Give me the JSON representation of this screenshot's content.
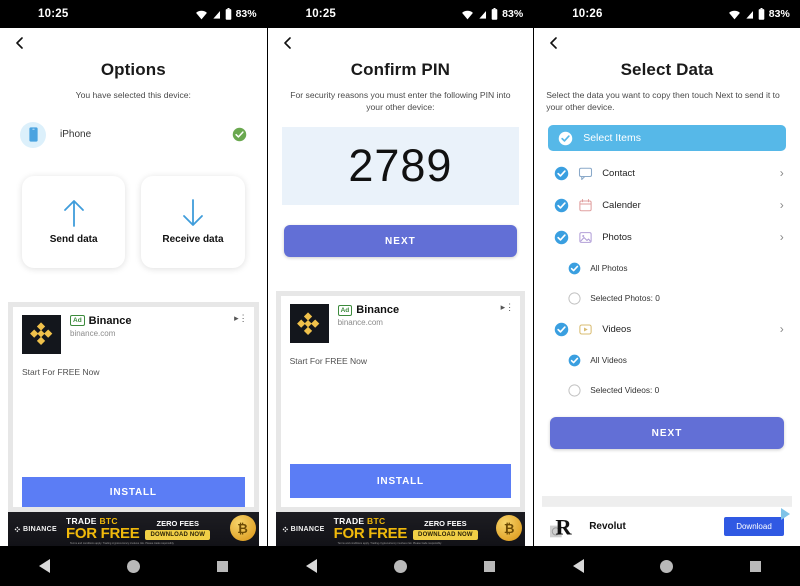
{
  "statusbar": {
    "time_left": "10:25",
    "time_mid": "10:25",
    "time_right": "10:26",
    "battery": "83%",
    "icons": [
      "wifi-icon",
      "signal-icon",
      "battery-icon"
    ]
  },
  "panel1": {
    "back_icon": "back-chevron-icon",
    "title": "Options",
    "subtitle": "You have selected this device:",
    "device": {
      "icon": "phone-icon",
      "name": "iPhone",
      "status_icon": "green-check-icon"
    },
    "cards": [
      {
        "icon": "arrow-up-icon",
        "label": "Send data"
      },
      {
        "icon": "arrow-down-icon",
        "label": "Receive data"
      }
    ],
    "ad": {
      "badge": "Ad",
      "brand": "Binance",
      "url": "binance.com",
      "tagline": "Start For FREE Now",
      "install_label": "INSTALL",
      "adchoices_icon": "adchoices-icon",
      "logo_icon": "binance-logo-icon"
    },
    "banner": {
      "brand": "BINANCE",
      "line1_a": "TRADE ",
      "line1_b": "BTC",
      "line2": "FOR FREE",
      "zero_fees": "ZERO FEES",
      "cta": "DOWNLOAD NOW",
      "fine_print": "Terms and conditions apply. Trading cryptocurrency involves risk. Please trade responsibly."
    }
  },
  "panel2": {
    "back_icon": "back-chevron-icon",
    "title": "Confirm PIN",
    "subtitle": "For security reasons you must enter the following PIN into your other device:",
    "pin": "2789",
    "next_label": "NEXT",
    "ad": {
      "badge": "Ad",
      "brand": "Binance",
      "url": "binance.com",
      "tagline": "Start For FREE Now",
      "install_label": "INSTALL",
      "adchoices_icon": "adchoices-icon",
      "logo_icon": "binance-logo-icon"
    },
    "banner": {
      "brand": "BINANCE",
      "line1_a": "TRADE ",
      "line1_b": "BTC",
      "line2": "FOR FREE",
      "zero_fees": "ZERO FEES",
      "cta": "DOWNLOAD NOW",
      "fine_print": "Terms and conditions apply. Trading cryptocurrency involves risk. Please trade responsibly."
    }
  },
  "panel3": {
    "back_icon": "back-chevron-icon",
    "title": "Select Data",
    "subtitle": "Select the data you want to copy then touch Next to send it to your other device.",
    "select_bar": {
      "label": "Select Items",
      "checked": true,
      "icon": "check-circle-icon"
    },
    "items": [
      {
        "label": "Contact",
        "icon": "chat-bubble-icon",
        "checked": true,
        "chevron": "›",
        "sub": false
      },
      {
        "label": "Calender",
        "icon": "calendar-icon",
        "checked": true,
        "chevron": "›",
        "sub": false
      },
      {
        "label": "Photos",
        "icon": "image-icon",
        "checked": true,
        "chevron": "›",
        "sub": false
      },
      {
        "label": "All Photos",
        "checked": true,
        "sub": true
      },
      {
        "label": "Selected Photos: 0",
        "checked": false,
        "sub": true
      },
      {
        "label": "Videos",
        "icon": "video-icon",
        "checked": true,
        "chevron": "›",
        "sub": false
      },
      {
        "label": "All Videos",
        "checked": true,
        "sub": true
      },
      {
        "label": "Selected Videos: 0",
        "checked": false,
        "sub": true
      }
    ],
    "next_label": "NEXT",
    "ad": {
      "brand": "Revolut",
      "cta": "Download",
      "logo_icon": "revolut-logo-icon",
      "adchoices_icon": "adchoices-icon"
    }
  },
  "navbar": {
    "back": "nav-back-icon",
    "home": "nav-home-icon",
    "recents": "nav-recents-icon"
  },
  "colors": {
    "accent_indigo": "#626fd6",
    "accent_lightblue": "#56b8e8",
    "checkbox_blue": "#3a9fe0",
    "arrow_blue": "#4aa3e0",
    "green_check": "#6aa84f",
    "install_blue": "#5b7df5",
    "binance_gold": "#f0b90b",
    "pin_bg": "#eaf2fa",
    "revolut_blue": "#3059e3"
  }
}
